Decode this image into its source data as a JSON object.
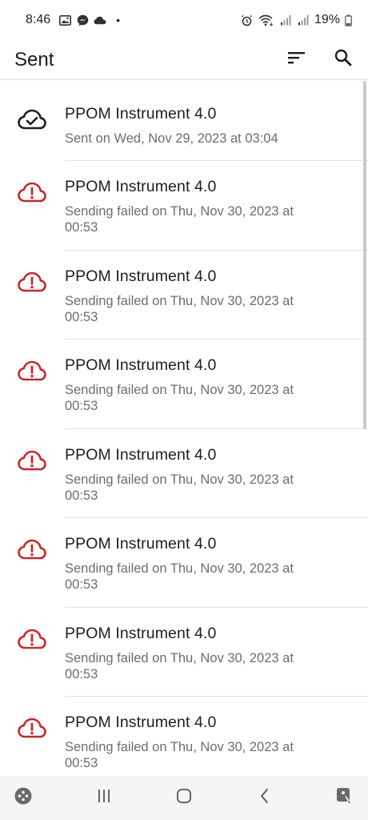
{
  "status_bar": {
    "time": "8:46",
    "dot": "•",
    "battery_percent": "19%",
    "left_icons": [
      "image-icon",
      "messenger-icon",
      "cloud-icon"
    ],
    "right_icons": [
      "alarm-icon",
      "wifi-icon",
      "signal-icon",
      "signal-icon-2",
      "battery-icon"
    ]
  },
  "app_bar": {
    "title": "Sent",
    "actions": [
      "sort-icon",
      "search-icon"
    ]
  },
  "colors": {
    "error_red": "#c62828",
    "success_dark": "#1d1d1d",
    "subtitle_gray": "#6d6d6d"
  },
  "items": [
    {
      "title": "PPOM Instrument 4.0",
      "subtitle": "Sent on Wed, Nov 29, 2023 at 03:04",
      "status_icon": "cloud-done-icon"
    },
    {
      "title": "PPOM Instrument 4.0",
      "subtitle": "Sending failed on Thu, Nov 30, 2023 at 00:53",
      "status_icon": "cloud-error-icon"
    },
    {
      "title": "PPOM Instrument 4.0",
      "subtitle": "Sending failed on Thu, Nov 30, 2023 at 00:53",
      "status_icon": "cloud-error-icon"
    },
    {
      "title": "PPOM Instrument 4.0",
      "subtitle": "Sending failed on Thu, Nov 30, 2023 at 00:53",
      "status_icon": "cloud-error-icon"
    },
    {
      "title": "PPOM Instrument 4.0",
      "subtitle": "Sending failed on Thu, Nov 30, 2023 at 00:53",
      "status_icon": "cloud-error-icon"
    },
    {
      "title": "PPOM Instrument 4.0",
      "subtitle": "Sending failed on Thu, Nov 30, 2023 at 00:53",
      "status_icon": "cloud-error-icon"
    },
    {
      "title": "PPOM Instrument 4.0",
      "subtitle": "Sending failed on Thu, Nov 30, 2023 at 00:53",
      "status_icon": "cloud-error-icon"
    },
    {
      "title": "PPOM Instrument 4.0",
      "subtitle": "Sending failed on Thu, Nov 30, 2023 at 00:53",
      "status_icon": "cloud-error-icon"
    }
  ],
  "nav_bar": {
    "buttons": [
      "game-launcher-icon",
      "recents-icon",
      "home-icon",
      "back-icon",
      "accessibility-icon"
    ]
  }
}
